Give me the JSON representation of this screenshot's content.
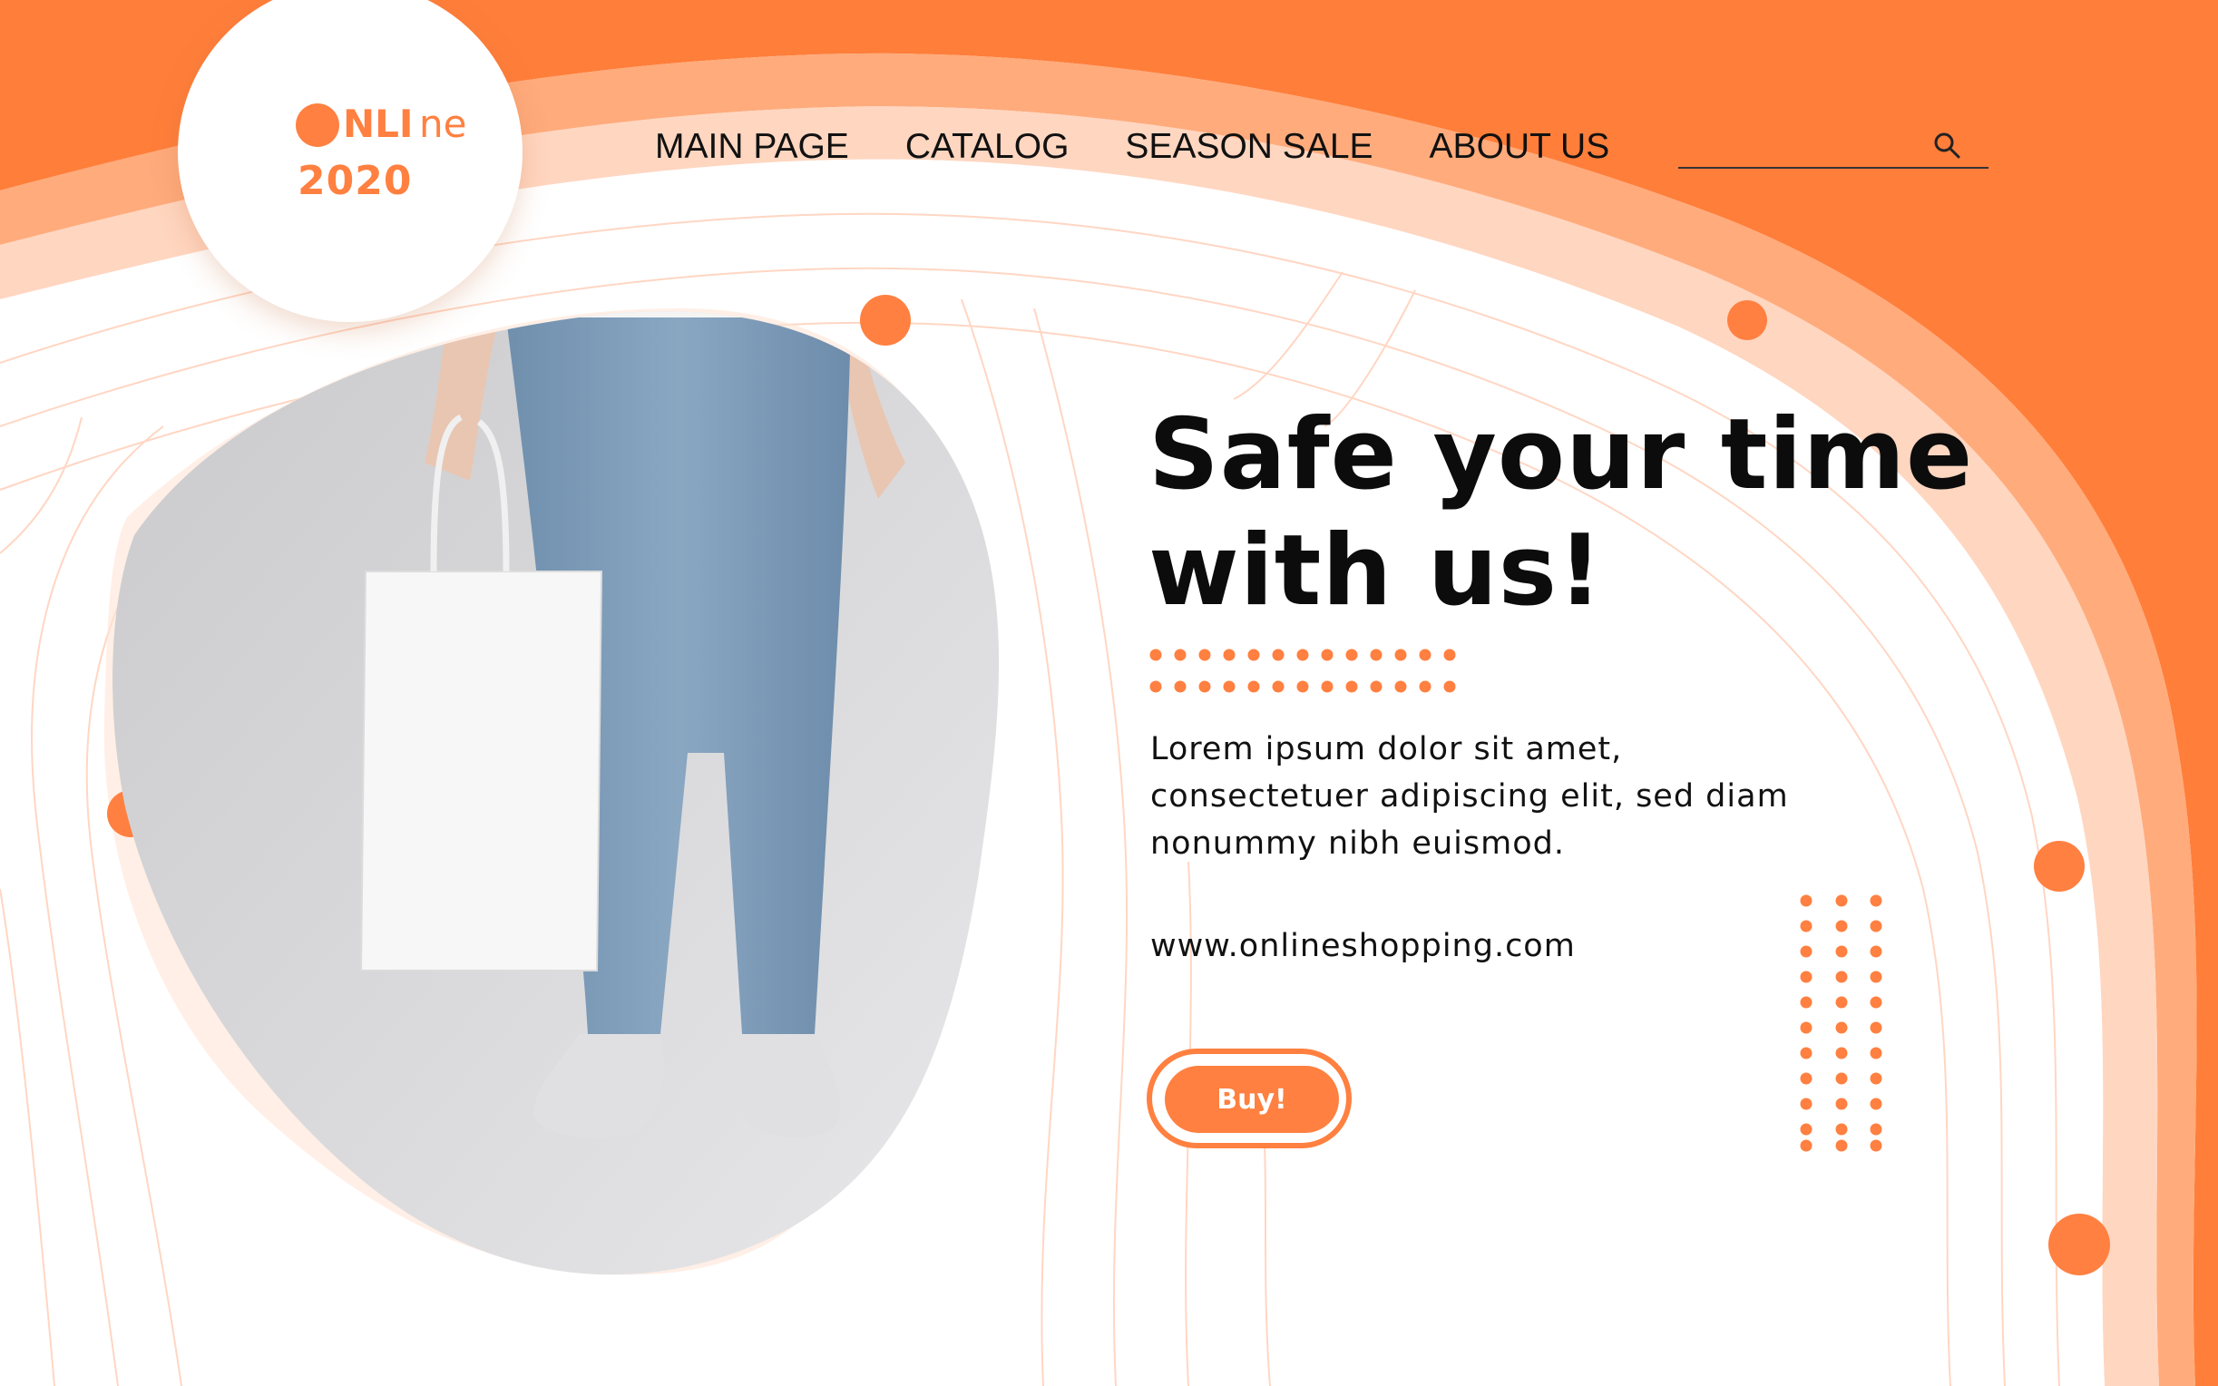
{
  "brand": {
    "logo_nli": "NLI",
    "logo_ne": "ne",
    "year": "2020",
    "accent_color": "#ff8040"
  },
  "nav": {
    "items": [
      {
        "label": "MAIN PAGE"
      },
      {
        "label": "CATALOG"
      },
      {
        "label": "SEASON SALE"
      },
      {
        "label": "ABOUT US"
      }
    ]
  },
  "search": {
    "value": "",
    "icon": "search-icon"
  },
  "hero": {
    "headline_line1": "Safe your time",
    "headline_line2": "with us!",
    "body_line1": "Lorem ipsum dolor sit amet,",
    "body_line2": "consectetuer adipiscing elit, sed diam",
    "body_line3": "nonummy nibh euismod.",
    "website": "www.onlineshopping.com",
    "buy_label": "Buy!"
  }
}
